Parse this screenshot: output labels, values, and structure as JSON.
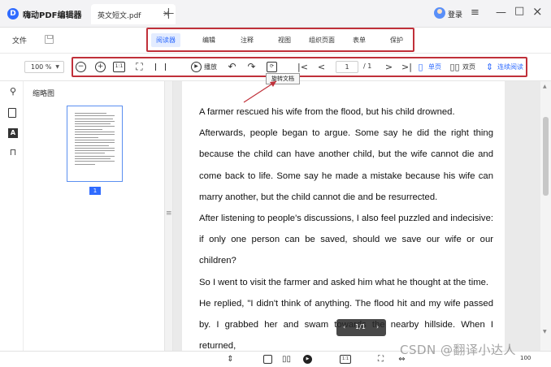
{
  "app": {
    "title": "嗨动PDF编辑器",
    "tab_title": "英文短文.pdf",
    "login_label": "登录"
  },
  "toolbar": {
    "file_label": "文件",
    "menu": [
      "阅读器",
      "编辑",
      "注释",
      "视图",
      "组织页面",
      "表单",
      "保护"
    ],
    "active_menu": "阅读器",
    "accent_color": "#2f6bff",
    "highlight_color": "#c0303a"
  },
  "subbar": {
    "zoom": "100 %",
    "one_to_one": "1:1",
    "play_label": "播放",
    "page_current": "1",
    "page_total": "/ 1",
    "single_page": "单页",
    "double_page": "双页",
    "continuous": "连续阅读",
    "tooltip": "旋转文档"
  },
  "sidebar": {
    "thumb_title": "缩略图",
    "thumb_page_number": "1"
  },
  "document": {
    "paragraphs": [
      "A farmer rescued his wife from the flood, but his child drowned.",
      "Afterwards, people began to argue. Some say he did the right thing because the child can have another child, but the wife cannot die and come back to life. Some say he made a mistake because his wife can marry another, but the child cannot die and be resurrected.",
      "After listening to people's discussions, I also feel puzzled and indecisive: if only one person can be saved, should we save our wife or our children?",
      "So I went to visit the farmer and asked him what he thought at the time.",
      "He replied, \"I didn't think of anything. The flood hit and my wife passed by. I grabbed her and swam towards the nearby hillside. When I returned,"
    ],
    "pager": "1/1"
  },
  "statusbar": {
    "one_to_one": "1:1",
    "zoom": "100"
  },
  "watermark": "CSDN @翻译小达人"
}
